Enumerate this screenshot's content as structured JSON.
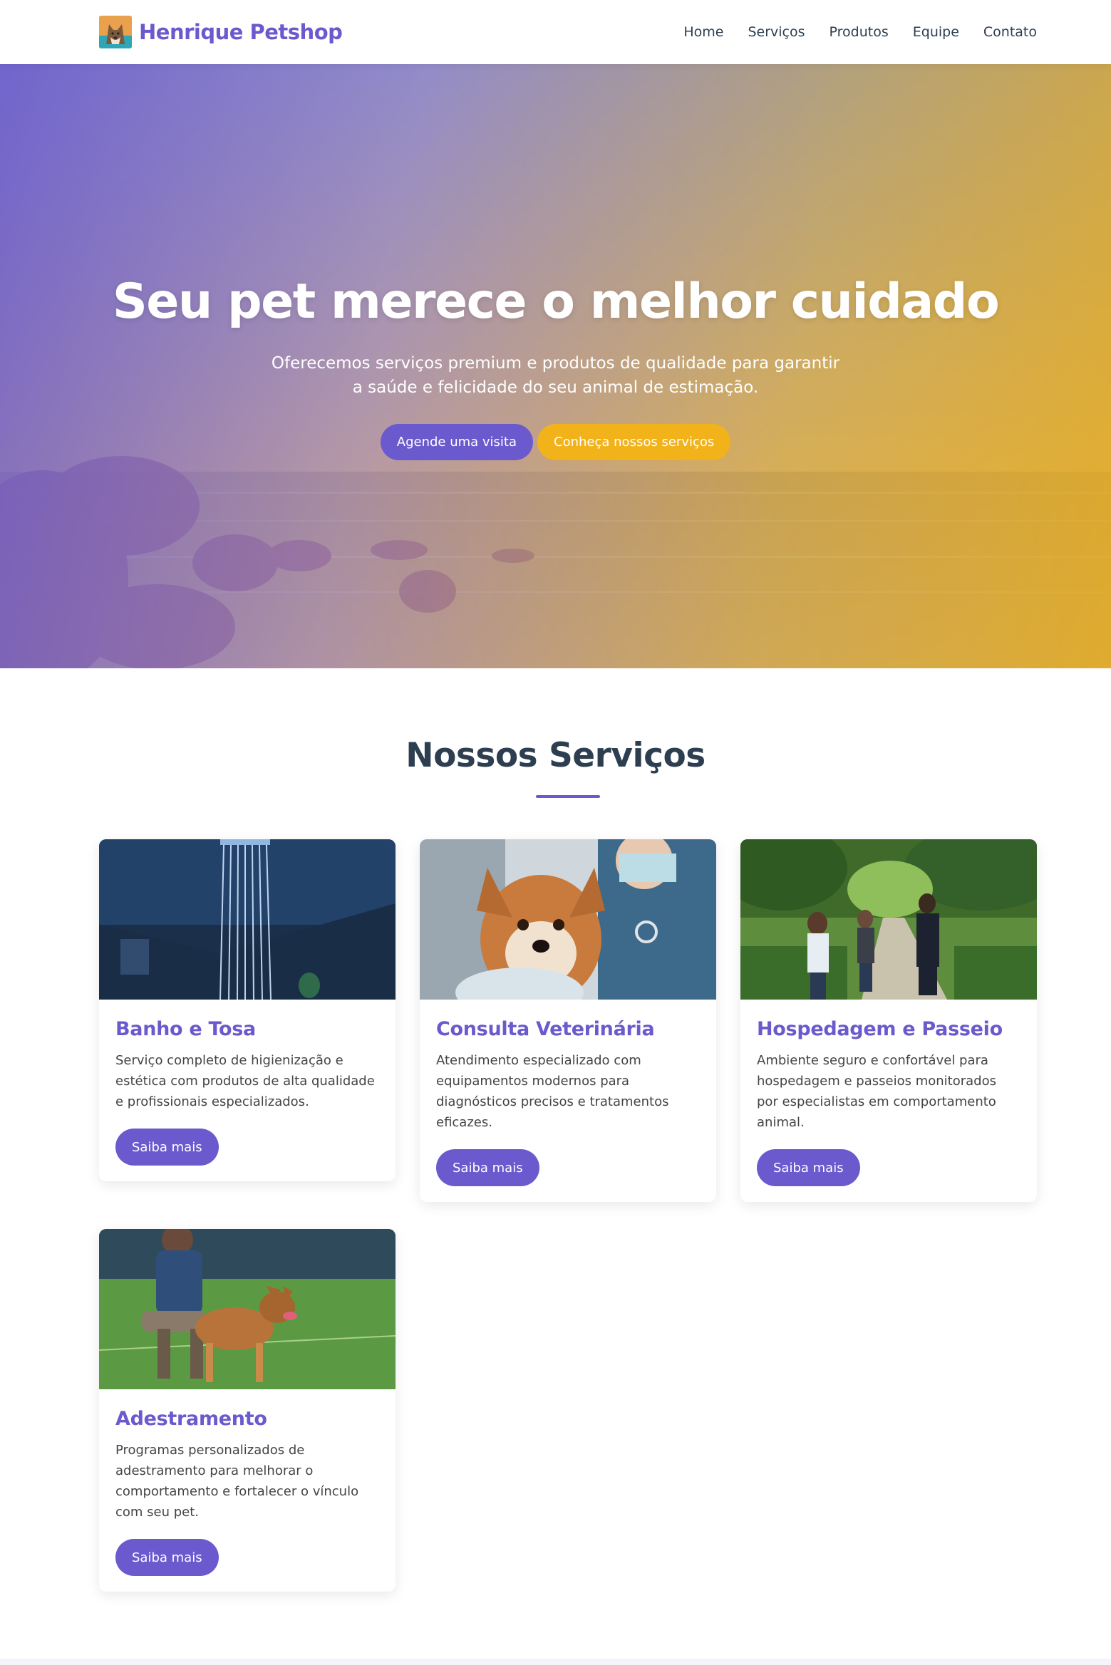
{
  "brand": {
    "name": "Henrique Petshop",
    "logo_icon": "dog-logo-icon",
    "color": "#6a5acd"
  },
  "nav": {
    "items": [
      {
        "label": "Home"
      },
      {
        "label": "Serviços"
      },
      {
        "label": "Produtos"
      },
      {
        "label": "Equipe"
      },
      {
        "label": "Contato"
      }
    ]
  },
  "hero": {
    "title": "Seu pet merece o melhor cuidado",
    "subtitle": "Oferecemos serviços premium e produtos de qualidade para garantir a saúde e felicidade do seu animal de estimação.",
    "primary_button": "Agende uma visita",
    "secondary_button": "Conheça nossos serviços",
    "gradient_start": "#6a5acd",
    "gradient_end": "#f2b21a"
  },
  "services": {
    "title": "Nossos Serviços",
    "cards": [
      {
        "image": "shower-image",
        "title": "Banho e Tosa",
        "text": "Serviço completo de higienização e estética com produtos de alta qualidade e profissionais especializados.",
        "button": "Saiba mais"
      },
      {
        "image": "vet-dog-image",
        "title": "Consulta Veterinária",
        "text": "Atendimento especializado com equipamentos modernos para diagnósticos precisos e tratamentos eficazes.",
        "button": "Saiba mais"
      },
      {
        "image": "park-walk-image",
        "title": "Hospedagem e Passeio",
        "text": "Ambiente seguro e confortável para hospedagem e passeios monitorados por especialistas em comportamento animal.",
        "button": "Saiba mais"
      },
      {
        "image": "dog-training-image",
        "title": "Adestramento",
        "text": "Programas personalizados de adestramento para melhorar o comportamento e fortalecer o vínculo com seu pet.",
        "button": "Saiba mais"
      }
    ]
  },
  "colors": {
    "accent": "#6a5acd",
    "secondary": "#f2b21a",
    "heading": "#2c3e50"
  }
}
